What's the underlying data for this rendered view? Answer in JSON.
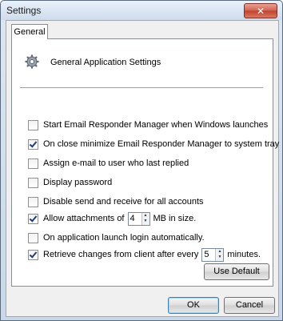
{
  "window": {
    "title": "Settings",
    "close_glyph": "✕"
  },
  "tabs": [
    {
      "label": "General"
    }
  ],
  "panel": {
    "header_icon": "gear-icon",
    "header_title": "General Application Settings"
  },
  "options": {
    "start_with_windows": {
      "label": "Start Email Responder Manager when Windows launches",
      "checked": false
    },
    "minimize_to_tray": {
      "label": "On close minimize Email Responder Manager to system tray",
      "checked": true
    },
    "assign_last_replied": {
      "label": "Assign e-mail to user who last replied",
      "checked": false
    },
    "display_password": {
      "label": "Display password",
      "checked": false
    },
    "disable_send_receive": {
      "label": "Disable send and receive for all accounts",
      "checked": false
    },
    "allow_attachments": {
      "label_before": "Allow attachments of",
      "value": "4",
      "label_after": "MB in size.",
      "checked": true
    },
    "login_automatically": {
      "label": "On application launch login automatically.",
      "checked": false
    },
    "retrieve_changes": {
      "label_before": "Retrieve changes from client after every",
      "value": "5",
      "label_after": "minutes.",
      "checked": true
    }
  },
  "buttons": {
    "use_default": "Use Default",
    "ok": "OK",
    "cancel": "Cancel"
  }
}
